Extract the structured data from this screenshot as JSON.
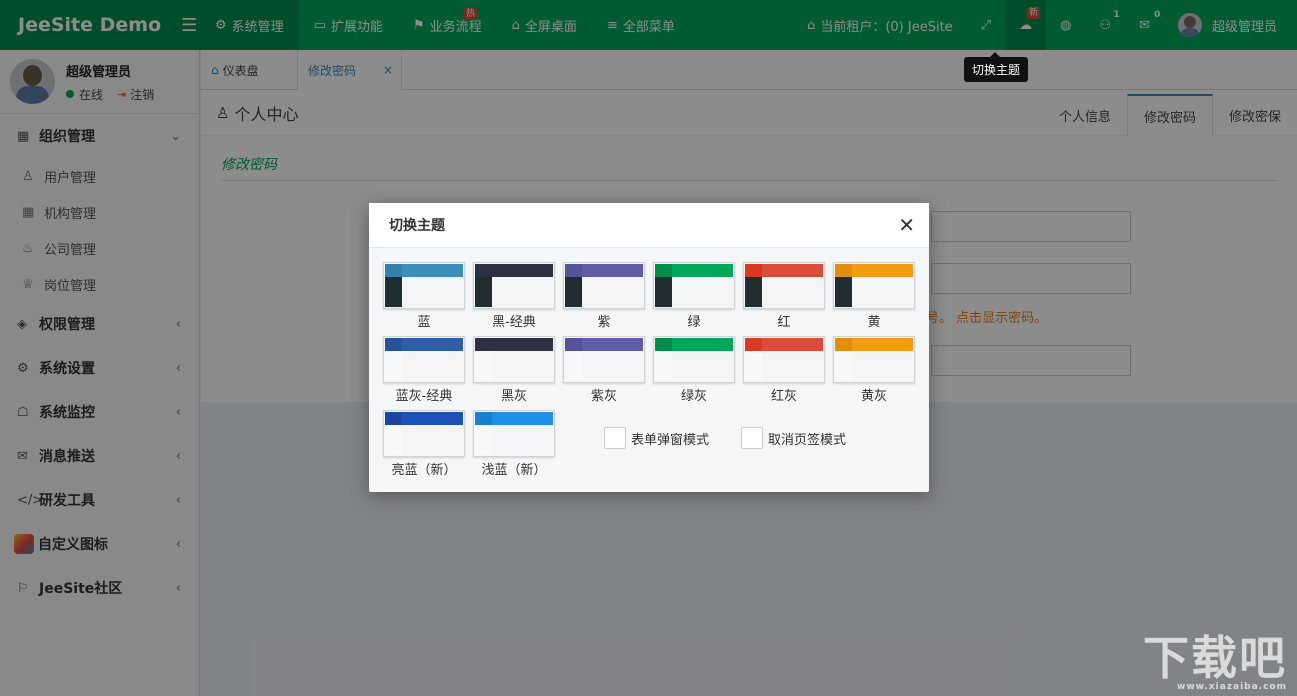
{
  "brand": {
    "name": "JeeSite Demo",
    "menu_icon": "hamburger-icon"
  },
  "topnav": [
    {
      "label": "系统管理",
      "icon": "gear-icon",
      "active": true
    },
    {
      "label": "扩展功能",
      "icon": "monitor-icon"
    },
    {
      "label": "业务流程",
      "icon": "flow-icon",
      "badge": "热"
    },
    {
      "label": "全屏桌面",
      "icon": "home-icon"
    },
    {
      "label": "全部菜单",
      "icon": "list-icon"
    }
  ],
  "topright": {
    "tenant": "当前租户：(0) JeeSite",
    "theme_badge": "新",
    "notify_count": "1",
    "mail_count": "0",
    "user": "超级管理员"
  },
  "tooltip": "切换主题",
  "sidebar": {
    "user_name": "超级管理员",
    "status": "在线",
    "logout": "注销",
    "groups": [
      {
        "label": "组织管理",
        "icon": "grid-icon",
        "expanded": true,
        "items": [
          {
            "label": "用户管理",
            "icon": "user-icon"
          },
          {
            "label": "机构管理",
            "icon": "grid-icon"
          },
          {
            "label": "公司管理",
            "icon": "fire-icon"
          },
          {
            "label": "岗位管理",
            "icon": "trophy-icon"
          }
        ]
      },
      {
        "label": "权限管理",
        "icon": "cube-icon"
      },
      {
        "label": "系统设置",
        "icon": "gear-icon"
      },
      {
        "label": "系统监控",
        "icon": "ghost-icon"
      },
      {
        "label": "消息推送",
        "icon": "inbox-icon"
      },
      {
        "label": "研发工具",
        "icon": "code-icon"
      },
      {
        "label": "自定义图标",
        "icon": "custom-icon"
      },
      {
        "label": "JeeSite社区",
        "icon": "signpost-icon"
      }
    ]
  },
  "tabs": [
    {
      "label": "仪表盘",
      "icon": "home-icon"
    },
    {
      "label": "修改密码",
      "active": true,
      "close": "×"
    }
  ],
  "page": {
    "title": "个人中心",
    "tabs": [
      "个人信息",
      "修改密码",
      "修改密保"
    ],
    "active_tab": "修改密码",
    "section": "修改密码",
    "hint": "号。 点击显示密码。"
  },
  "modal": {
    "title": "切换主题",
    "close": "✕",
    "themes": [
      {
        "label": "蓝",
        "header": "#3c8dbc",
        "logo": "#367fa9",
        "side": "#222d32"
      },
      {
        "label": "黑-经典",
        "header": "#2d3142",
        "logo": "#2d3142",
        "side": "#222d32"
      },
      {
        "label": "紫",
        "header": "#605ca8",
        "logo": "#555299",
        "side": "#222d32"
      },
      {
        "label": "绿",
        "header": "#00a65a",
        "logo": "#008d4c",
        "side": "#222d32"
      },
      {
        "label": "红",
        "header": "#dd4b39",
        "logo": "#d73925",
        "side": "#222d32"
      },
      {
        "label": "黄",
        "header": "#f39c12",
        "logo": "#e08e0b",
        "side": "#222d32"
      },
      {
        "label": "蓝灰-经典",
        "header": "#2c5fa8",
        "logo": "#27539a",
        "side": "#f4f5f7"
      },
      {
        "label": "黑灰",
        "header": "#2d3142",
        "logo": "#2d3142",
        "side": "#f4f5f7"
      },
      {
        "label": "紫灰",
        "header": "#605ca8",
        "logo": "#555299",
        "side": "#f4f5f7"
      },
      {
        "label": "绿灰",
        "header": "#00a65a",
        "logo": "#008d4c",
        "side": "#f4f5f7"
      },
      {
        "label": "红灰",
        "header": "#dd4b39",
        "logo": "#d73925",
        "side": "#f4f5f7"
      },
      {
        "label": "黄灰",
        "header": "#f39c12",
        "logo": "#e08e0b",
        "side": "#f4f5f7"
      },
      {
        "label": "亮蓝（新）",
        "header": "#1e52b8",
        "logo": "#1a46a0",
        "side": "#f4f5f7"
      },
      {
        "label": "浅蓝（新）",
        "header": "#1e90e8",
        "logo": "#1a7fd0",
        "side": "#f4f5f7"
      }
    ],
    "options": [
      "表单弹窗模式",
      "取消页签模式"
    ]
  },
  "watermark": {
    "text": "下载吧",
    "sub": "www.xiazaiba.com"
  },
  "colors": {
    "primary": "#00a65a",
    "primary_dark": "#008d4c",
    "accent": "#3c8dbc"
  }
}
